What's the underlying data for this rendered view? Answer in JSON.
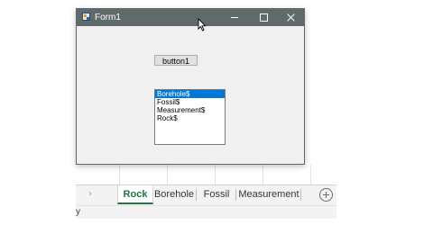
{
  "window": {
    "title": "Form1",
    "button1_label": "button1",
    "listbox": {
      "items": [
        "Borehole$",
        "Fossil$",
        "Measurement$",
        "Rock$"
      ],
      "selected_index": 0
    }
  },
  "excel": {
    "tabs": [
      "Rock",
      "Borehole",
      "Fossil",
      "Measurement"
    ],
    "active_tab": "Rock",
    "status_text": "y"
  },
  "colors": {
    "titlebar": "#5f6a6a",
    "selection": "#0078d7",
    "excel_green": "#217346"
  }
}
